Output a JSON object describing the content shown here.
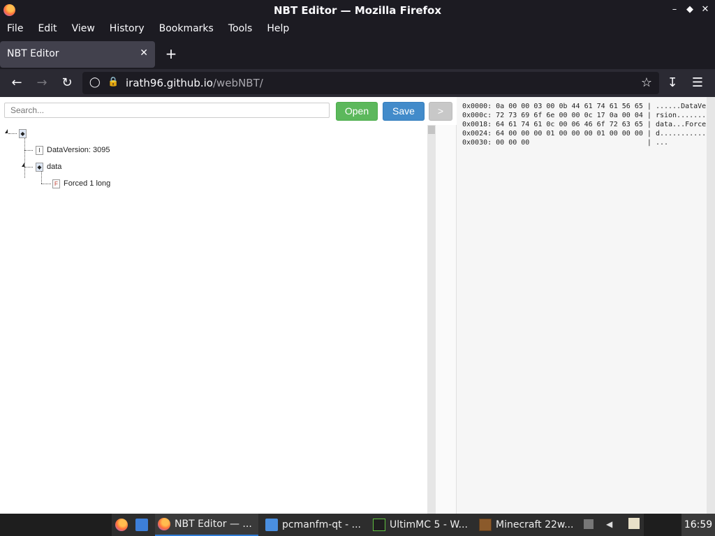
{
  "window": {
    "title": "NBT Editor — Mozilla Firefox",
    "controls": [
      "minimize-icon",
      "maximize-icon",
      "close-icon"
    ]
  },
  "menubar": {
    "items": [
      "File",
      "Edit",
      "View",
      "History",
      "Bookmarks",
      "Tools",
      "Help"
    ]
  },
  "tabs": [
    {
      "label": "NBT Editor",
      "active": true
    }
  ],
  "nav": {
    "url_host": "irath96.github.io",
    "url_path": "/webNBT/"
  },
  "toolbar": {
    "search_placeholder": "Search...",
    "open_label": "Open",
    "save_label": "Save",
    "next_label": ">"
  },
  "tree": {
    "nodes": [
      {
        "label": "",
        "type": "compound-icon"
      },
      {
        "label": "DataVersion: 3095",
        "type": "int-icon",
        "icon_text": "I"
      },
      {
        "label": "data",
        "type": "compound-icon"
      },
      {
        "label": "Forced 1 long",
        "type": "long-array-icon",
        "icon_text": "F"
      }
    ]
  },
  "hexview": {
    "lines": [
      "0x0000: 0a 00 00 03 00 0b 44 61 74 61 56 65 | ......DataVe",
      "0x000c: 72 73 69 6f 6e 00 00 0c 17 0a 00 04 | rsion.......",
      "0x0018: 64 61 74 61 0c 00 06 46 6f 72 63 65 | data...Force",
      "0x0024: 64 00 00 00 01 00 00 00 01 00 00 00 | d...........",
      "0x0030: 00 00 00                            | ..."
    ]
  },
  "taskbar": {
    "items": [
      {
        "label": "NBT Editor — ...",
        "icon": "firefox-icon",
        "active": true
      },
      {
        "label": "pcmanfm-qt - ...",
        "icon": "folder-icon",
        "active": false
      },
      {
        "label": "UltimMC 5 - W...",
        "icon": "terminal-icon",
        "active": false
      },
      {
        "label": "Minecraft 22w...",
        "icon": "minecraft-icon",
        "active": false
      }
    ],
    "clock": "16:59"
  }
}
